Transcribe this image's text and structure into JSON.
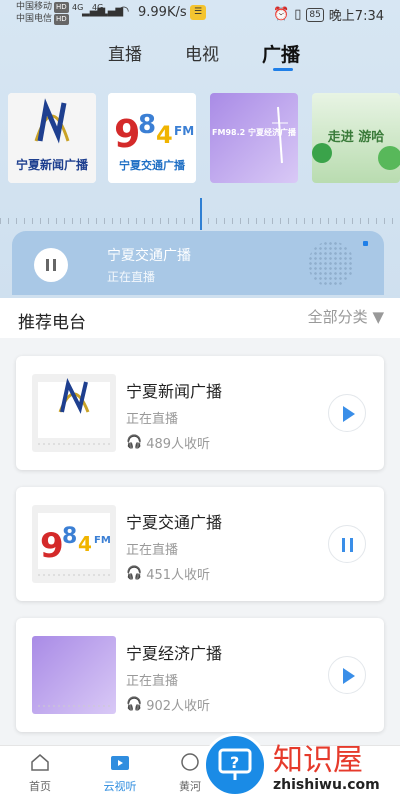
{
  "status_bar": {
    "carrier_1": "中国移动",
    "carrier_2": "中国电信",
    "hd_1": "HD",
    "hd_2": "HD",
    "net_1": "4G",
    "net_2": "4G",
    "speed": "9.99K/s",
    "battery": "85",
    "time": "晚上7:34"
  },
  "tabs": [
    {
      "label": "直播",
      "active": false
    },
    {
      "label": "电视",
      "active": false
    },
    {
      "label": "广播",
      "active": true
    }
  ],
  "covers": [
    {
      "label": "宁夏新闻广播"
    },
    {
      "label": "宁夏交通广播"
    },
    {
      "label": "FM98.2 宁夏经济广播"
    },
    {
      "label": "走进 游哈"
    }
  ],
  "now_playing": {
    "title": "宁夏交通广播",
    "status": "正在直播"
  },
  "section": {
    "title": "推荐电台",
    "filter_label": "全部分类"
  },
  "stations": [
    {
      "name": "宁夏新闻广播",
      "status": "正在直播",
      "listeners": "489人收听",
      "playing": false
    },
    {
      "name": "宁夏交通广播",
      "status": "正在直播",
      "listeners": "451人收听",
      "playing": true
    },
    {
      "name": "宁夏经济广播",
      "status": "正在直播",
      "listeners": "902人收听",
      "playing": false
    }
  ],
  "bottom_nav": [
    {
      "label": "首页",
      "icon": "home-icon",
      "active": false
    },
    {
      "label": "云视听",
      "icon": "tv-icon",
      "active": true
    },
    {
      "label": "黄河",
      "icon": "news-icon",
      "active": false
    }
  ],
  "watermark": {
    "text": "知识屋",
    "url": "zhishiwu.com"
  },
  "colors": {
    "accent": "#1f7fe8",
    "player_bg": "#a9c8e6",
    "header_bg": "#d7e6f3"
  }
}
